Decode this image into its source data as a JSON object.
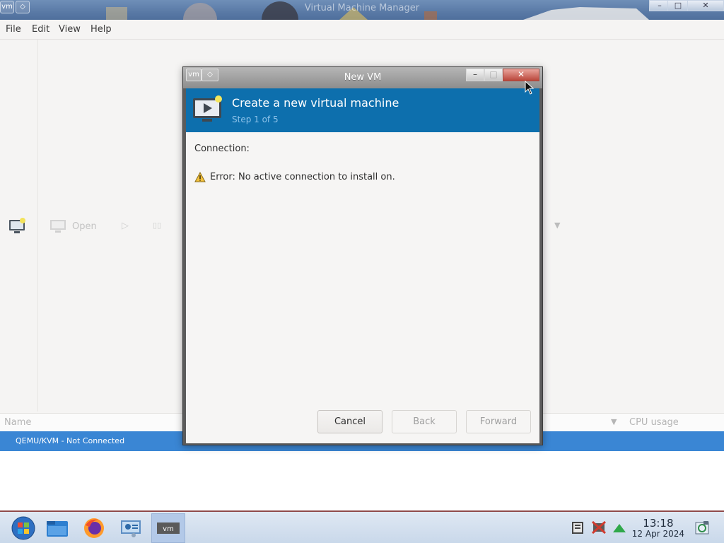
{
  "main_window": {
    "title": "Virtual Machine Manager",
    "menu": [
      "File",
      "Edit",
      "View",
      "Help"
    ],
    "toolbar": {
      "open_label": "Open"
    },
    "list": {
      "columns": [
        "Name",
        "CPU usage"
      ],
      "rows": [
        {
          "name": "QEMU/KVM - Not Connected"
        }
      ]
    }
  },
  "dialog": {
    "title": "New VM",
    "banner_title": "Create a new virtual machine",
    "banner_step": "Step 1 of 5",
    "connection_label": "Connection:",
    "error_text": "Error: No active connection to install on.",
    "buttons": {
      "cancel": "Cancel",
      "back": "Back",
      "forward": "Forward"
    }
  },
  "taskbar": {
    "time": "13:18",
    "date": "12 Apr 2024"
  },
  "colors": {
    "banner": "#0d6fad",
    "selection": "#3a86d4",
    "taskbar": "#c9d8ea"
  },
  "icons": [
    "windows-start-icon",
    "file-manager-icon",
    "firefox-icon",
    "network-settings-icon",
    "virt-manager-icon",
    "clipboard-icon",
    "network-disconnected-icon",
    "update-arrow-icon",
    "screenshot-icon",
    "monitor-icon",
    "warning-icon"
  ]
}
